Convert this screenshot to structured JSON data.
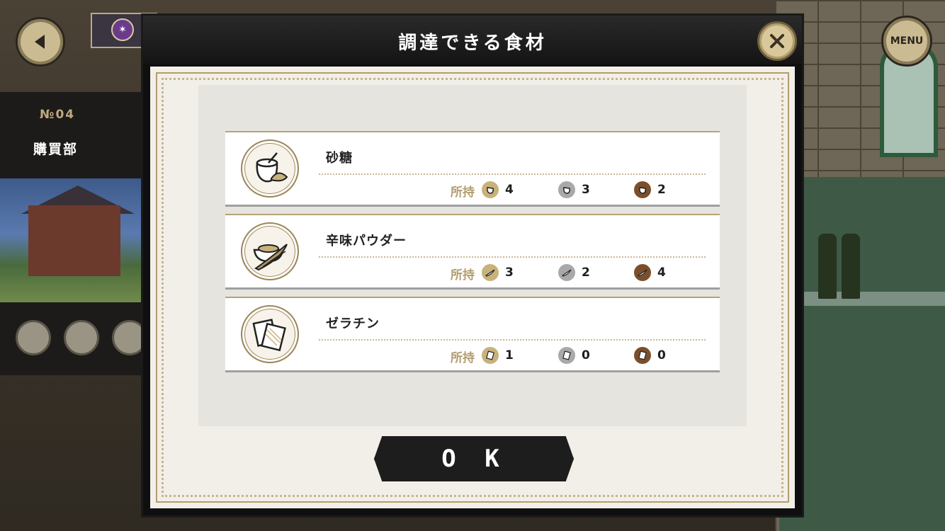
{
  "sidebar": {
    "no_label": "№04",
    "name": "購買部"
  },
  "menu_button": "MENU",
  "modal": {
    "title": "調達できる食材",
    "ok_label": "O K",
    "items": [
      {
        "name": "砂糖",
        "icon": "sugar-icon",
        "owned_label": "所持",
        "counts": [
          4,
          3,
          2
        ]
      },
      {
        "name": "辛味パウダー",
        "icon": "spicy-powder-icon",
        "owned_label": "所持",
        "counts": [
          3,
          2,
          4
        ]
      },
      {
        "name": "ゼラチン",
        "icon": "gelatin-icon",
        "owned_label": "所持",
        "counts": [
          1,
          0,
          0
        ]
      }
    ]
  },
  "colors": {
    "grade_gold": "#c8b27a",
    "grade_silver": "#a9a9a9",
    "grade_bronze": "#7b4f2c",
    "accent": "#b29d6f"
  }
}
